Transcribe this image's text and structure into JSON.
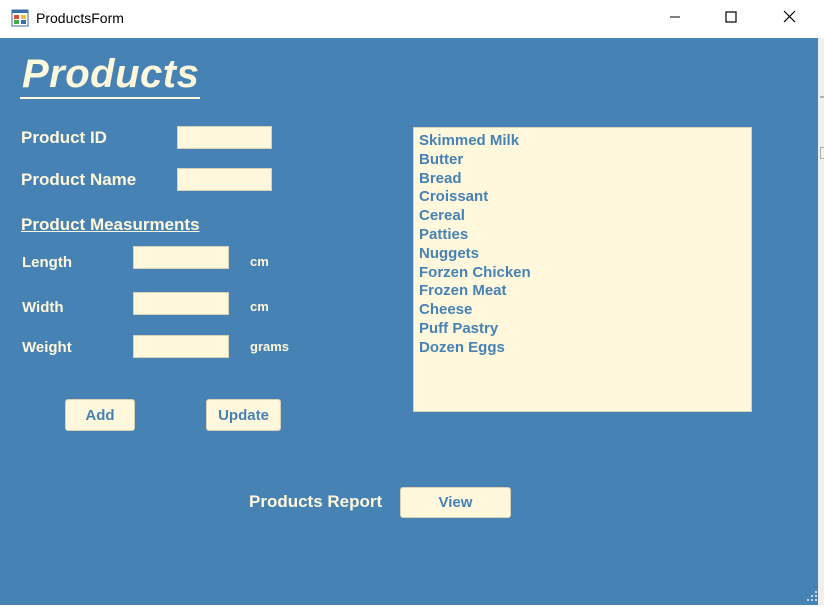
{
  "window": {
    "title": "ProductsForm",
    "controls": {
      "minimize": "minimize-icon",
      "maximize": "maximize-icon",
      "close": "close-icon"
    }
  },
  "form": {
    "heading": "Products",
    "product_id_label": "Product ID",
    "product_id_value": "",
    "product_name_label": "Product Name",
    "product_name_value": "",
    "measurements_heading": "Product Measurments",
    "length_label": "Length",
    "length_value": "",
    "length_unit": "cm",
    "width_label": "Width",
    "width_value": "",
    "width_unit": "cm",
    "weight_label": "Weight",
    "weight_value": "",
    "weight_unit": "grams",
    "add_button": "Add",
    "update_button": "Update",
    "report_label": "Products Report",
    "view_button": "View"
  },
  "products_list": [
    "Skimmed Milk",
    "Butter",
    "Bread",
    "Croissant",
    "Cereal",
    "Patties",
    "Nuggets",
    "Forzen Chicken",
    "Frozen Meat",
    "Cheese",
    "Puff Pastry",
    "Dozen Eggs"
  ],
  "colors": {
    "background": "#4682b4",
    "field": "#fff8dc",
    "text_light": "#fff8dc",
    "text_accent": "#4682b4"
  }
}
